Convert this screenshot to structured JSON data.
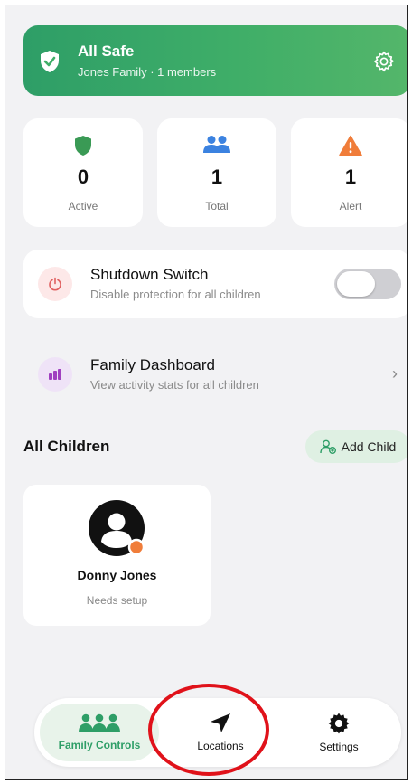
{
  "banner": {
    "title": "All Safe",
    "subtitle": "Jones Family · 1 members",
    "icon": "shield-check-icon",
    "settings_icon": "gear-icon",
    "color": "#3fae68"
  },
  "stats": [
    {
      "value": "0",
      "label": "Active",
      "icon": "shield-icon",
      "color": "#3a9a55"
    },
    {
      "value": "1",
      "label": "Total",
      "icon": "users-icon",
      "color": "#3b82e0"
    },
    {
      "value": "1",
      "label": "Alert",
      "icon": "warning-icon",
      "color": "#f07d3a"
    }
  ],
  "shutdown": {
    "title": "Shutdown Switch",
    "subtitle": "Disable protection for all children",
    "icon": "power-icon",
    "enabled": false
  },
  "dashboard": {
    "title": "Family Dashboard",
    "subtitle": "View activity stats for all children",
    "icon": "bar-chart-icon"
  },
  "children_section": {
    "title": "All Children",
    "add_label": "Add Child"
  },
  "children": [
    {
      "name": "Donny Jones",
      "status": "Needs setup",
      "status_color": "#f07d3a"
    }
  ],
  "tabs": [
    {
      "label": "Family Controls",
      "icon": "family-icon",
      "active": true
    },
    {
      "label": "Locations",
      "icon": "navigation-arrow-icon",
      "active": false
    },
    {
      "label": "Settings",
      "icon": "gear-icon",
      "active": false
    }
  ]
}
